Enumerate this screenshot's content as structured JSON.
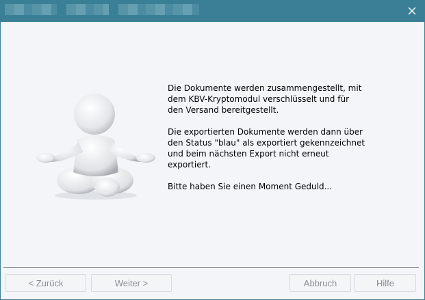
{
  "window": {
    "close_icon": "close-icon",
    "title_bar_color": "#3a7f96"
  },
  "illustration": {
    "icon": "meditating-figure-icon"
  },
  "message": {
    "paragraph1": "Die Dokumente werden zusammengestellt, mit\ndem KBV-Kryptomodul verschlüsselt und für\nden Versand bereitgestellt.",
    "paragraph2": "Die exportierten Dokumente werden dann über\nden Status \"blau\" als exportiert gekennzeichnet\nund beim nächsten Export nicht erneut\nexportiert.",
    "paragraph3": "Bitte haben Sie einen Moment Geduld..."
  },
  "buttons": {
    "back": "< Zurück",
    "next": "Weiter >",
    "cancel": "Abbruch",
    "help": "Hilfe"
  }
}
